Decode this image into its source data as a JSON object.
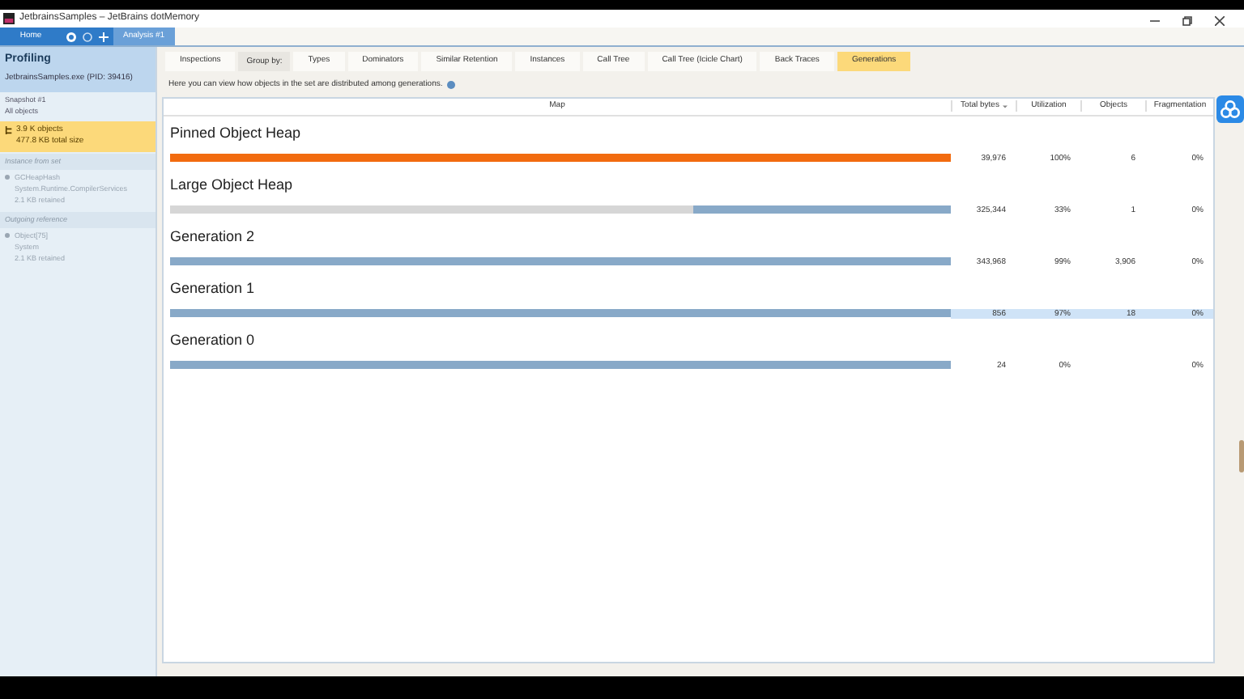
{
  "window": {
    "title": "JetbrainsSamples – JetBrains dotMemory"
  },
  "toolbar": {
    "tabs": [
      {
        "label": "Home",
        "selected": false
      },
      {
        "label": "Analysis #1",
        "selected": true
      }
    ]
  },
  "sidebar": {
    "title": "Profiling",
    "subtitle": "JetbrainsSamples.exe (PID: 39416)",
    "snapshot": {
      "name": "Snapshot #1",
      "filter": "All objects"
    },
    "object_set": {
      "count": "3.9 K objects",
      "size": "477.8 KB total size"
    },
    "sections": [
      {
        "title": "Instance from set",
        "lines": [
          "GCHeapHash",
          "System.Runtime.CompilerServices",
          "2.1 KB retained"
        ]
      },
      {
        "title": "Outgoing reference",
        "lines": [
          "Object[75]",
          "System",
          "2.1 KB retained"
        ]
      }
    ]
  },
  "view_tabs": [
    {
      "label": "Inspections",
      "kind": "tab",
      "selected": false
    },
    {
      "label": "Group by:",
      "kind": "label"
    },
    {
      "label": "Types",
      "kind": "tab",
      "selected": false
    },
    {
      "label": "Dominators",
      "kind": "tab",
      "selected": false
    },
    {
      "label": "Similar Retention",
      "kind": "tab",
      "selected": false
    },
    {
      "label": "Instances",
      "kind": "tab",
      "selected": false
    },
    {
      "label": "Call Tree",
      "kind": "tab",
      "selected": false
    },
    {
      "label": "Call Tree (Icicle Chart)",
      "kind": "tab",
      "selected": false
    },
    {
      "label": "Back Traces",
      "kind": "tab",
      "selected": false
    },
    {
      "label": "Generations",
      "kind": "tab",
      "selected": true
    }
  ],
  "description": "Here you can view how objects in the set are distributed among generations.",
  "table": {
    "columns": [
      "Map",
      "Total bytes",
      "Utilization",
      "Objects",
      "Fragmentation"
    ],
    "rows": [
      {
        "name": "Pinned Object Heap",
        "color": "#f26b0f",
        "level": 1,
        "total_bytes": "39,976",
        "utilization": "100%",
        "objects": "6",
        "fragmentation": "0%",
        "selected": false
      },
      {
        "name": "Large Object Heap",
        "color": "#88a9c8",
        "level": 0.33,
        "total_bytes": "325,344",
        "utilization": "33%",
        "objects": "1",
        "fragmentation": "0%",
        "selected": false
      },
      {
        "name": "Generation 2",
        "color": "#88a9c8",
        "level": 1,
        "total_bytes": "343,968",
        "utilization": "99%",
        "objects": "3,906",
        "fragmentation": "0%",
        "selected": false
      },
      {
        "name": "Generation 1",
        "color": "#88a9c8",
        "level": 1,
        "total_bytes": "856",
        "utilization": "97%",
        "objects": "18",
        "fragmentation": "0%",
        "selected": true
      },
      {
        "name": "Generation 0",
        "color": "#88a9c8",
        "level": 1,
        "total_bytes": "24",
        "utilization": "0%",
        "fragmentation": "0%",
        "selected": false
      }
    ]
  }
}
